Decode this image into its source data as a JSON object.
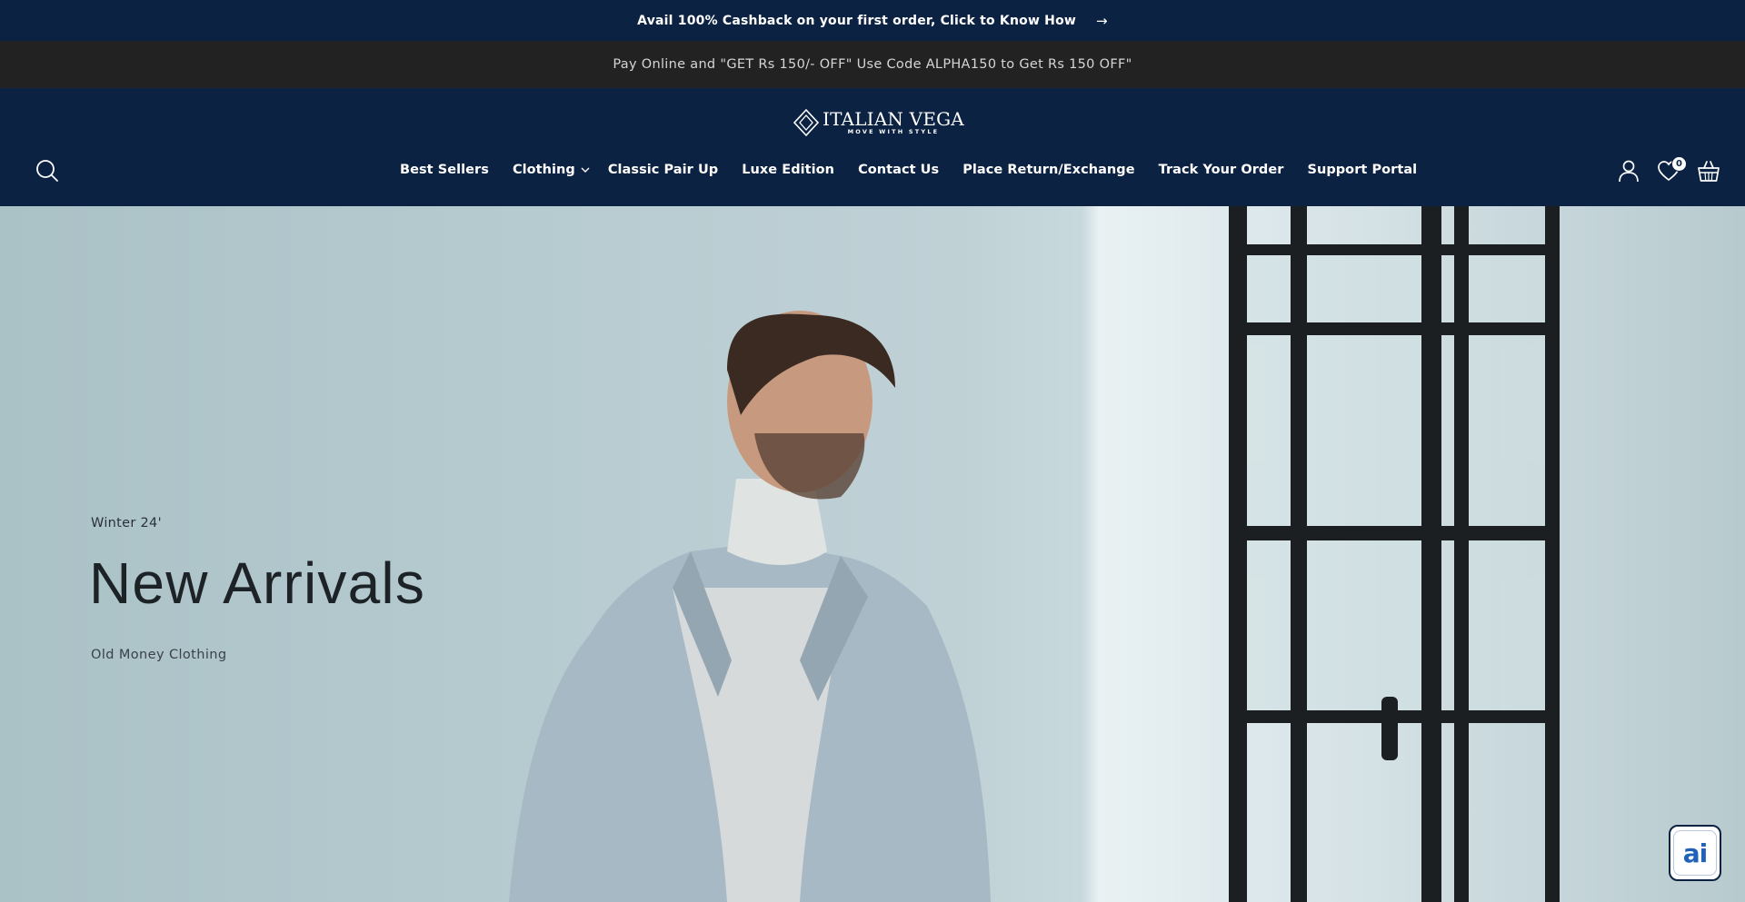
{
  "announcement": {
    "text": "Avail 100% Cashback on your first order, Click to Know How",
    "arrow_icon": "arrow-right-icon"
  },
  "promo_bar": {
    "text": "Pay Online and \"GET Rs 150/- OFF\" Use Code ALPHA150 to Get Rs 150 OFF\""
  },
  "header": {
    "logo": {
      "name": "ITALIAN VEGA",
      "tagline": "MOVE WITH STYLE"
    },
    "search_icon": "search-icon",
    "nav": [
      {
        "label": "Best Sellers"
      },
      {
        "label": "Clothing",
        "has_dropdown": true
      },
      {
        "label": "Classic Pair Up"
      },
      {
        "label": "Luxe Edition"
      },
      {
        "label": "Contact Us"
      },
      {
        "label": "Place Return/Exchange"
      },
      {
        "label": "Track Your Order"
      },
      {
        "label": "Support Portal"
      }
    ],
    "icons": {
      "account": "account-icon",
      "wishlist": "heart-icon",
      "cart": "basket-icon"
    },
    "wishlist_count": "0"
  },
  "hero": {
    "eyebrow": "Winter 24'",
    "headline": "New Arrivals",
    "subtext": "Old Money Clothing"
  },
  "chat_widget": {
    "label": "ai"
  },
  "colors": {
    "navy": "#0c2242",
    "promo_bg": "#222222",
    "hero_bg": "#b6cbd0",
    "chat_accent": "#1f62b8"
  }
}
